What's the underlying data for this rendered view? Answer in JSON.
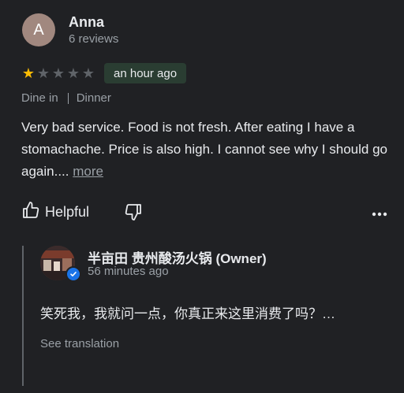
{
  "reviewer": {
    "avatar_letter": "A",
    "avatar_color": "#a1887f",
    "name": "Anna",
    "reviews": "6 reviews"
  },
  "rating": {
    "value": 1,
    "max": 5,
    "filled_color": "#fbbc04",
    "empty_color": "#5f6368"
  },
  "time_badge": "an hour ago",
  "meta": {
    "dining": "Dine in",
    "meal": "Dinner"
  },
  "review_text": "Very bad service. Food is not fresh. After eating I have a stomachache. Price is also high. I cannot see why I should go again....",
  "more_label": "more",
  "actions": {
    "helpful_label": "Helpful",
    "dislike_icon": "thumbs-down-icon",
    "more_icon": "more-horiz-icon"
  },
  "owner_reply": {
    "name": "半亩田 贵州酸汤火锅 (Owner)",
    "time": "56 minutes ago",
    "text": "笑死我，我就问一点，你真正来这里消费了吗？…",
    "translate_label": "See translation"
  }
}
